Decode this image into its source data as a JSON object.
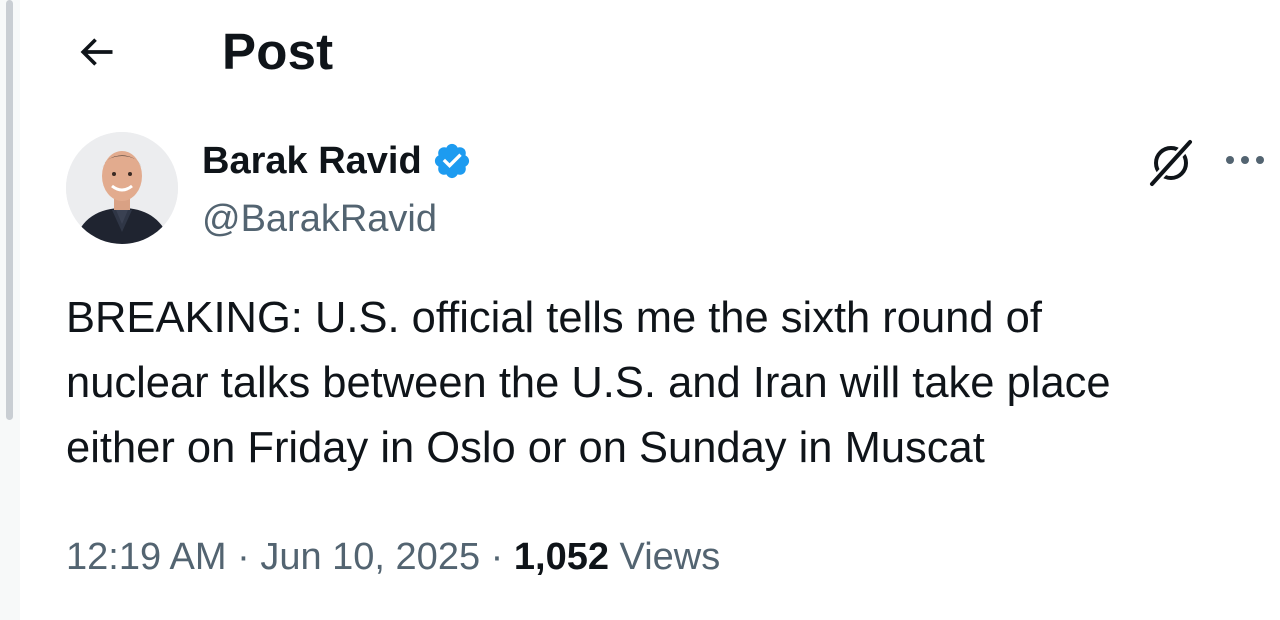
{
  "header": {
    "title": "Post",
    "back_icon": "arrow-left-icon"
  },
  "post": {
    "author": {
      "display_name": "Barak Ravid",
      "handle": "@BarakRavid",
      "verified_color": "#1d9bf0",
      "avatar_icon": "user-avatar"
    },
    "text": "BREAKING: U.S. official tells me the sixth round of\nnuclear talks between the U.S. and Iran will take place\neither on Friday in Oslo or on Sunday in Muscat",
    "meta": {
      "time": "12:19 AM",
      "separator": "·",
      "date": "Jun 10, 2025",
      "views_count": "1,052",
      "views_label": "Views"
    },
    "actions": {
      "grok_icon": "grok-icon",
      "more_icon": "more-options-icon"
    }
  },
  "colors": {
    "text_primary": "#0f1419",
    "text_secondary": "#536471",
    "accent": "#1d9bf0",
    "background": "#ffffff"
  }
}
